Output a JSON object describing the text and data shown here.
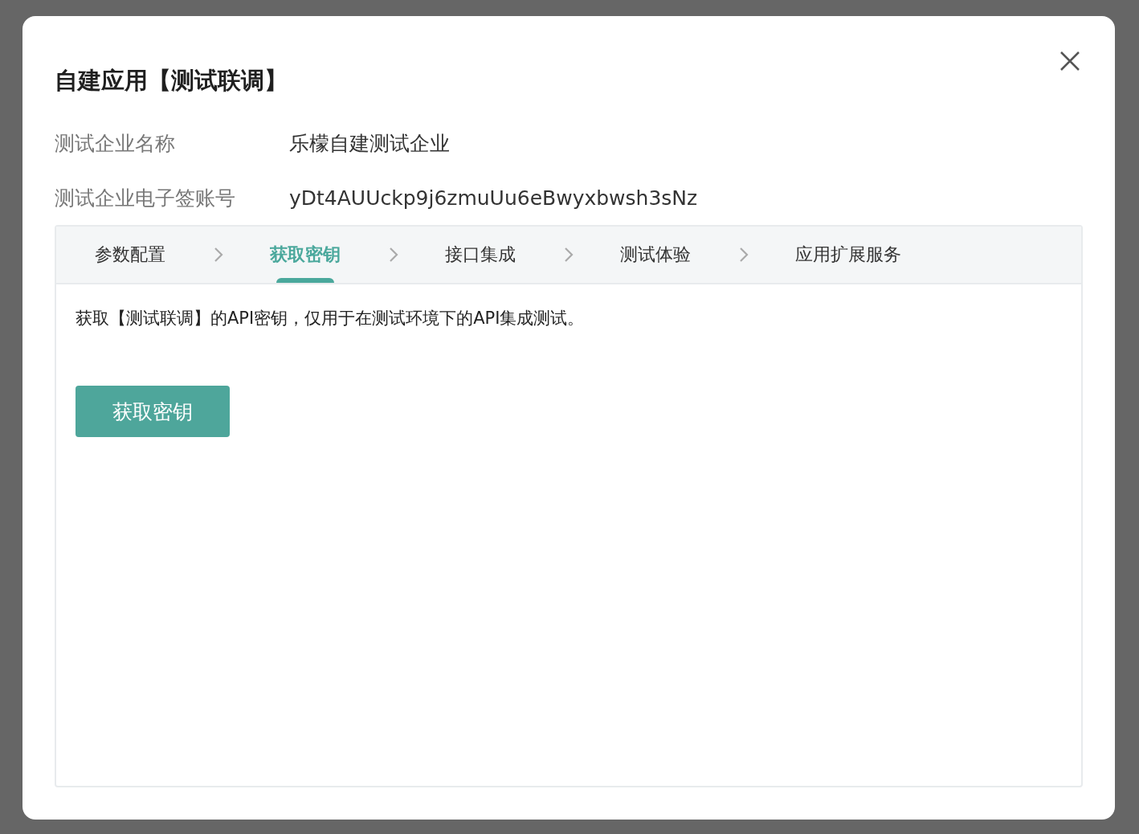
{
  "dialog": {
    "title": "自建应用【测试联调】",
    "fields": [
      {
        "label": "测试企业名称",
        "value": "乐檬自建测试企业"
      },
      {
        "label": "测试企业电子签账号",
        "value": "yDt4AUUckp9j6zmuUu6eBwyxbwsh3sNz"
      }
    ],
    "steps": [
      {
        "label": "参数配置",
        "selected": false
      },
      {
        "label": "获取密钥",
        "selected": true
      },
      {
        "label": "接口集成",
        "selected": false
      },
      {
        "label": "测试体验",
        "selected": false
      },
      {
        "label": "应用扩展服务",
        "selected": false
      }
    ],
    "description": "获取【测试联调】的API密钥，仅用于在测试环境下的API集成测试。",
    "button": "获取密钥"
  }
}
